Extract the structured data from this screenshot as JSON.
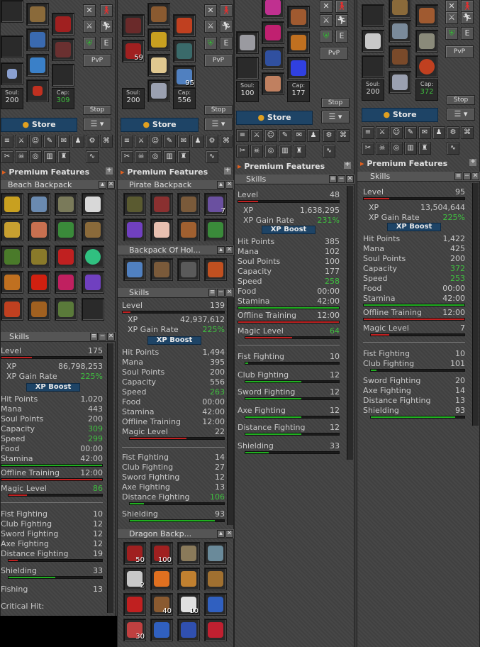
{
  "store": "Store",
  "premium": "Premium Features",
  "stop": "Stop",
  "pvp": "PvP",
  "e": "E",
  "skills_title": "Skills",
  "xp_boost": "XP Boost",
  "labels": {
    "level": "Level",
    "xp": "XP",
    "xp_gain": "XP Gain Rate",
    "hp": "Hit Points",
    "mana": "Mana",
    "soul": "Soul Points",
    "cap": "Capacity",
    "speed": "Speed",
    "food": "Food",
    "stamina": "Stamina",
    "offline": "Offline Training",
    "magic": "Magic Level",
    "fist": "Fist Fighting",
    "club": "Club Fighting",
    "sword": "Sword Fighting",
    "axe": "Axe Fighting",
    "dist": "Distance Fighting",
    "shield": "Shielding",
    "fishing": "Fishing",
    "crit": "Critical Hit:"
  },
  "cols": [
    {
      "soul_label": "Soul:",
      "soul": "200",
      "cap_label": "Cap:",
      "cap": "309",
      "backpack": "Beach Backpack",
      "skills": {
        "level": "175",
        "xp": "86,798,253",
        "xp_gain": "225%",
        "hp": "1,020",
        "mana": "443",
        "soul": "200",
        "cap": "309",
        "speed": "299",
        "food": "00:00",
        "stamina": "42:00",
        "offline": "12:00",
        "magic": "86",
        "fist": "10",
        "club": "12",
        "sword": "12",
        "axe": "12",
        "dist": "19",
        "shield": "33",
        "fishing": "13"
      }
    },
    {
      "soul_label": "Soul:",
      "soul": "200",
      "cap_label": "Cap:",
      "cap": "556",
      "backpack": "Pirate Backpack",
      "backpack2": "Backpack Of Hol...",
      "backpack3": "Dragon Backp...",
      "counts": [
        "59",
        "95"
      ],
      "pirate_counts": [
        "7"
      ],
      "dragon_counts": [
        "50",
        "100",
        "2",
        "40",
        "10",
        "30"
      ],
      "skills": {
        "level": "139",
        "xp": "42,937,612",
        "xp_gain": "225%",
        "hp": "1,494",
        "mana": "395",
        "soul": "200",
        "cap": "556",
        "speed": "263",
        "food": "00:00",
        "stamina": "42:00",
        "offline": "12:00",
        "magic": "22",
        "fist": "14",
        "club": "27",
        "sword": "12",
        "axe": "13",
        "dist": "106",
        "shield": "93"
      }
    },
    {
      "soul_label": "Soul:",
      "soul": "100",
      "cap_label": "Cap:",
      "cap": "177",
      "skills": {
        "level": "48",
        "xp": "1,638,295",
        "xp_gain": "231%",
        "hp": "385",
        "mana": "102",
        "soul": "100",
        "cap": "177",
        "speed": "258",
        "food": "00:00",
        "stamina": "42:00",
        "offline": "12:00",
        "magic": "64",
        "fist": "10",
        "club": "12",
        "sword": "12",
        "axe": "12",
        "dist": "12",
        "shield": "33"
      }
    },
    {
      "soul_label": "Soul:",
      "soul": "200",
      "cap_label": "Cap:",
      "cap": "372",
      "skills": {
        "level": "95",
        "xp": "13,504,644",
        "xp_gain": "225%",
        "hp": "1,422",
        "mana": "425",
        "soul": "200",
        "cap": "372",
        "speed": "253",
        "food": "00:00",
        "stamina": "42:00",
        "offline": "12:00",
        "magic": "7",
        "fist": "10",
        "club": "101",
        "sword": "20",
        "axe": "14",
        "dist": "13",
        "shield": "93"
      }
    }
  ]
}
